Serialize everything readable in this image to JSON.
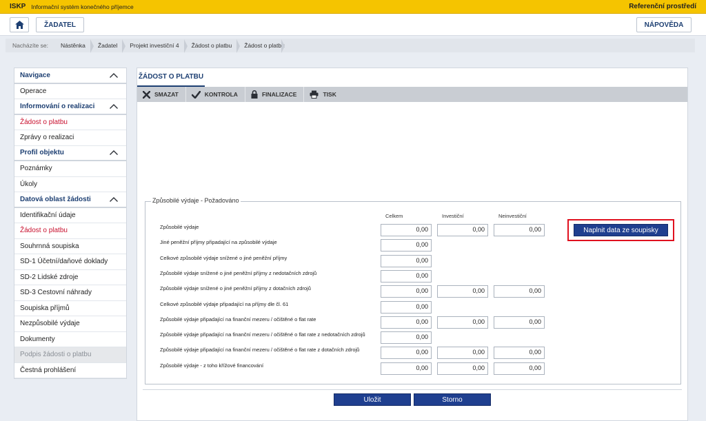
{
  "topbar": {
    "brand": "ISKP",
    "system_name": "Informační systém konečného příjemce",
    "environment": "Referenční prostředí"
  },
  "header": {
    "home_icon": "home-icon",
    "zadatel_label": "ŽADATEL",
    "help_label": "NÁPOVĚDA"
  },
  "breadcrumb": {
    "label": "Nacházíte se:",
    "items": [
      "Nástěnka",
      "Žadatel",
      "Projekt investiční 4",
      "Žádost o platbu",
      "Žádost o platbu"
    ]
  },
  "nav": {
    "items": [
      {
        "label": "Navigace",
        "type": "section"
      },
      {
        "label": "Operace",
        "type": "item"
      },
      {
        "label": "Informování o realizaci",
        "type": "section"
      },
      {
        "label": "Žádost o platbu",
        "type": "active"
      },
      {
        "label": "Zprávy o realizaci",
        "type": "item"
      },
      {
        "label": "Profil objektu",
        "type": "section"
      },
      {
        "label": "Poznámky",
        "type": "item"
      },
      {
        "label": "Úkoly",
        "type": "item"
      },
      {
        "label": "Datová oblast žádosti",
        "type": "section"
      },
      {
        "label": "Identifikační údaje",
        "type": "item"
      },
      {
        "label": "Žádost o platbu",
        "type": "active"
      },
      {
        "label": "Souhrnná soupiska",
        "type": "item"
      },
      {
        "label": "SD-1 Účetní/daňové doklady",
        "type": "item"
      },
      {
        "label": "SD-2 Lidské zdroje",
        "type": "item"
      },
      {
        "label": "SD-3 Cestovní náhrady",
        "type": "item"
      },
      {
        "label": "Soupiska příjmů",
        "type": "item"
      },
      {
        "label": "Nezpůsobilé výdaje",
        "type": "item"
      },
      {
        "label": "Dokumenty",
        "type": "item"
      },
      {
        "label": "Podpis žádosti o platbu",
        "type": "disabled"
      },
      {
        "label": "Čestná prohlášení",
        "type": "item"
      }
    ]
  },
  "main": {
    "tab_label": "ŽÁDOST O PLATBU",
    "toolbar": [
      {
        "label": "SMAZAT",
        "icon": "close-icon"
      },
      {
        "label": "KONTROLA",
        "icon": "check-icon"
      },
      {
        "label": "FINALIZACE",
        "icon": "lock-icon"
      },
      {
        "label": "TISK",
        "icon": "printer-icon"
      }
    ],
    "section_title": "Způsobilé výdaje - Požadováno",
    "columns": [
      "Celkem",
      "Investiční",
      "Neinvestiční"
    ],
    "rows": [
      {
        "label": "Způsobilé výdaje",
        "values": [
          "0,00",
          "0,00",
          "0,00"
        ]
      },
      {
        "label": "Jiné peněžní příjmy připadající na způsobilé výdaje",
        "values": [
          "0,00"
        ]
      },
      {
        "label": "Celkové způsobilé výdaje snížené o jiné peněžní příjmy",
        "values": [
          "0,00"
        ]
      },
      {
        "label": "Způsobilé výdaje snížené o jiné peněžní příjmy z nedotačních zdrojů",
        "values": [
          "0,00"
        ]
      },
      {
        "label": "Způsobilé výdaje snížené o jiné peněžní příjmy z dotačních zdrojů",
        "values": [
          "0,00",
          "0,00",
          "0,00"
        ]
      },
      {
        "label": "Celkové způsobilé výdaje připadající na příjmy dle čl. 61",
        "values": [
          "0,00"
        ]
      },
      {
        "label": "Způsobilé výdaje připadající na finanční mezeru / očištěné o flat rate",
        "values": [
          "0,00",
          "0,00",
          "0,00"
        ]
      },
      {
        "label": "Způsobilé výdaje připadající na finanční mezeru / očištěné o flat rate z nedotačních zdrojů",
        "values": [
          "0,00"
        ]
      },
      {
        "label": "Způsobilé výdaje připadající na finanční mezeru / očištěné o flat rate z dotačních zdrojů",
        "values": [
          "0,00",
          "0,00",
          "0,00"
        ]
      },
      {
        "label": "Způsobilé výdaje - z toho křížové financování",
        "values": [
          "0,00",
          "0,00",
          "0,00"
        ]
      }
    ],
    "fill_button_label": "Naplnit data ze soupisky",
    "save_label": "Uložit",
    "cancel_label": "Storno"
  },
  "colors": {
    "accent_yellow": "#f5c400",
    "primary_blue": "#1f3f8f",
    "active_red": "#c8102e",
    "highlight_red": "#e0101e"
  }
}
